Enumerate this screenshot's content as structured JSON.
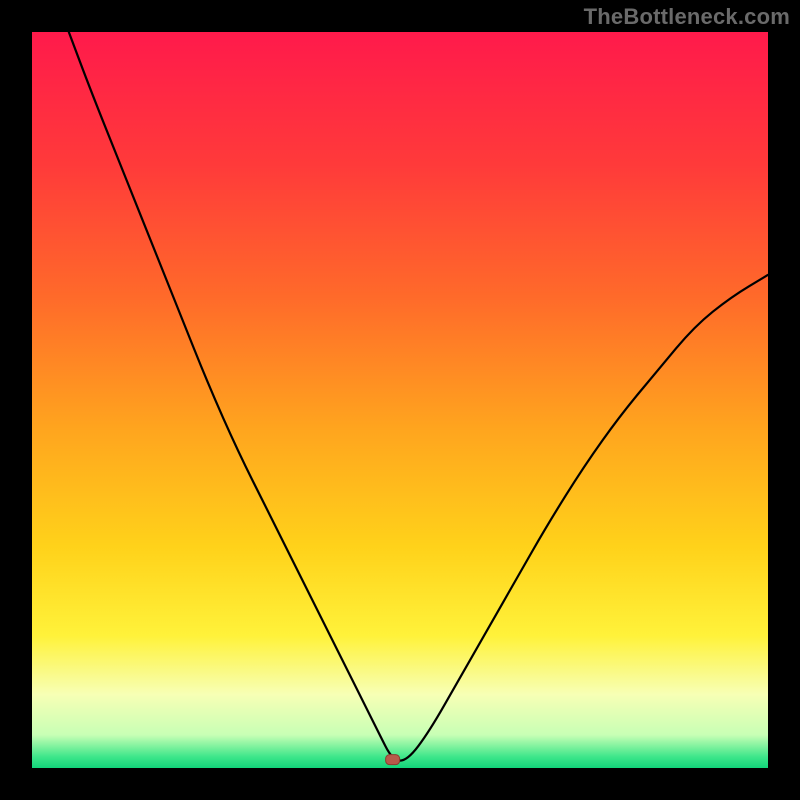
{
  "watermark": "TheBottleneck.com",
  "colors": {
    "frame": "#000000",
    "watermark": "#6a6a6a",
    "gradient_stops": [
      {
        "offset": 0.0,
        "color": "#ff1a4b"
      },
      {
        "offset": 0.18,
        "color": "#ff3a3a"
      },
      {
        "offset": 0.36,
        "color": "#ff6a2a"
      },
      {
        "offset": 0.54,
        "color": "#ffa51e"
      },
      {
        "offset": 0.7,
        "color": "#ffd21a"
      },
      {
        "offset": 0.82,
        "color": "#fff23a"
      },
      {
        "offset": 0.9,
        "color": "#f7ffb5"
      },
      {
        "offset": 0.955,
        "color": "#c8ffb5"
      },
      {
        "offset": 0.985,
        "color": "#3de68a"
      },
      {
        "offset": 1.0,
        "color": "#12d47a"
      }
    ],
    "curve": "#000000",
    "marker_fill": "#b75a4a",
    "marker_stroke": "#8a3d30"
  },
  "chart_data": {
    "type": "line",
    "title": "",
    "xlabel": "",
    "ylabel": "",
    "xlim": [
      0,
      100
    ],
    "ylim": [
      0,
      100
    ],
    "grid": false,
    "legend": false,
    "minimum": {
      "x": 49,
      "y": 1
    },
    "series": [
      {
        "name": "bottleneck-curve",
        "x": [
          5,
          8,
          12,
          16,
          20,
          24,
          28,
          32,
          36,
          40,
          43,
          45,
          47,
          49,
          51,
          54,
          58,
          62,
          66,
          70,
          75,
          80,
          85,
          90,
          95,
          100
        ],
        "y": [
          100,
          92,
          82,
          72,
          62,
          52,
          43,
          35,
          27,
          19,
          13,
          9,
          5,
          1,
          1,
          5,
          12,
          19,
          26,
          33,
          41,
          48,
          54,
          60,
          64,
          67
        ]
      }
    ]
  }
}
